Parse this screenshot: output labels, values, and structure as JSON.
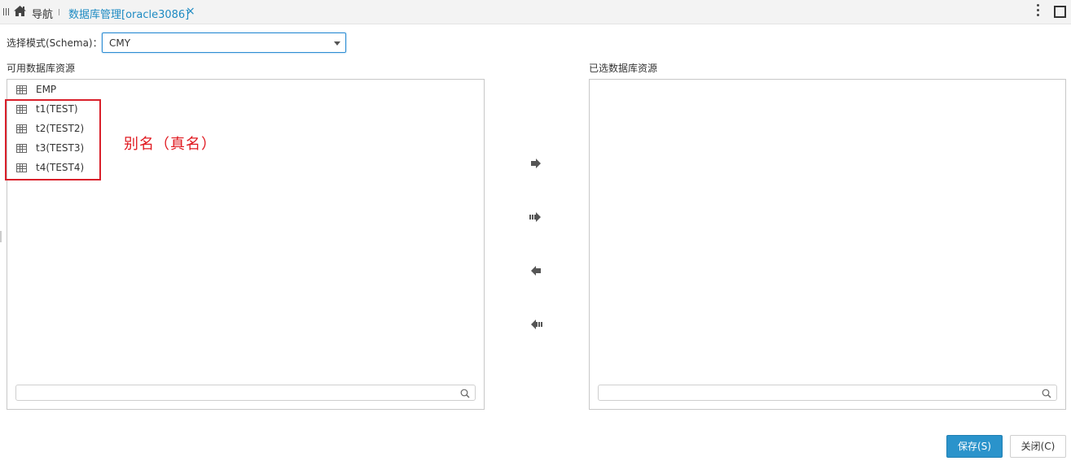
{
  "topbar": {
    "nav_label": "导航",
    "active_tab_label": "数据库管理[oracle3086]",
    "close_glyph": "×",
    "accent_color": "#1e8bc3"
  },
  "schema": {
    "label": "选择模式(Schema)：",
    "selected_value": "CMY"
  },
  "available_panel": {
    "title": "可用数据库资源",
    "items": [
      {
        "label": "EMP",
        "icon": "table-icon"
      },
      {
        "label": "t1(TEST)",
        "icon": "table-icon"
      },
      {
        "label": "t2(TEST2)",
        "icon": "table-icon"
      },
      {
        "label": "t3(TEST3)",
        "icon": "table-icon"
      },
      {
        "label": "t4(TEST4)",
        "icon": "table-icon"
      }
    ],
    "search_placeholder": ""
  },
  "selected_panel": {
    "title": "已选数据库资源",
    "items": [],
    "search_placeholder": ""
  },
  "annotation": {
    "text": "别名（真名）",
    "color": "#e0181f"
  },
  "transfer_buttons": [
    "move-right-icon",
    "move-all-right-icon",
    "move-left-icon",
    "move-all-left-icon"
  ],
  "footer": {
    "save_label": "保存(S)",
    "close_label": "关闭(C)",
    "primary_color": "#2a93cb"
  }
}
